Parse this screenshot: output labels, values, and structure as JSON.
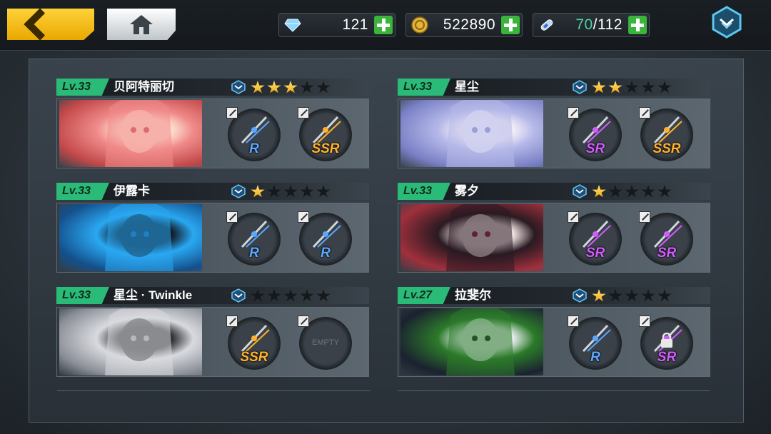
{
  "currencies": [
    {
      "icon": "diamond-icon",
      "value": "121"
    },
    {
      "icon": "gold-coin-icon",
      "value": "522890"
    },
    {
      "icon": "stamina-icon",
      "current": "70",
      "max": "/112"
    }
  ],
  "colors": {
    "level_badge": "#2bbb79",
    "star_on": "#f3a300",
    "back_button": "#ffd23a"
  },
  "characters": [
    {
      "level": "Lv.33",
      "name": "贝阿特丽切",
      "stars": 3,
      "weapons": [
        {
          "rank": "R"
        },
        {
          "rank": "SSR"
        }
      ]
    },
    {
      "level": "Lv.33",
      "name": "星尘",
      "stars": 2,
      "weapons": [
        {
          "rank": "SR"
        },
        {
          "rank": "SSR"
        }
      ]
    },
    {
      "level": "Lv.33",
      "name": "伊露卡",
      "stars": 1,
      "weapons": [
        {
          "rank": "R"
        },
        {
          "rank": "R"
        }
      ]
    },
    {
      "level": "Lv.33",
      "name": "雾夕",
      "stars": 1,
      "weapons": [
        {
          "rank": "SR"
        },
        {
          "rank": "SR"
        }
      ]
    },
    {
      "level": "Lv.33",
      "name": "星尘 · Twinkle",
      "stars": 0,
      "weapons": [
        {
          "rank": "SSR"
        },
        {
          "rank": "",
          "empty": "EMPTY"
        }
      ]
    },
    {
      "level": "Lv.27",
      "name": "拉斐尔",
      "stars": 1,
      "weapons": [
        {
          "rank": "R"
        },
        {
          "rank": "SR",
          "locked": true
        }
      ]
    }
  ]
}
